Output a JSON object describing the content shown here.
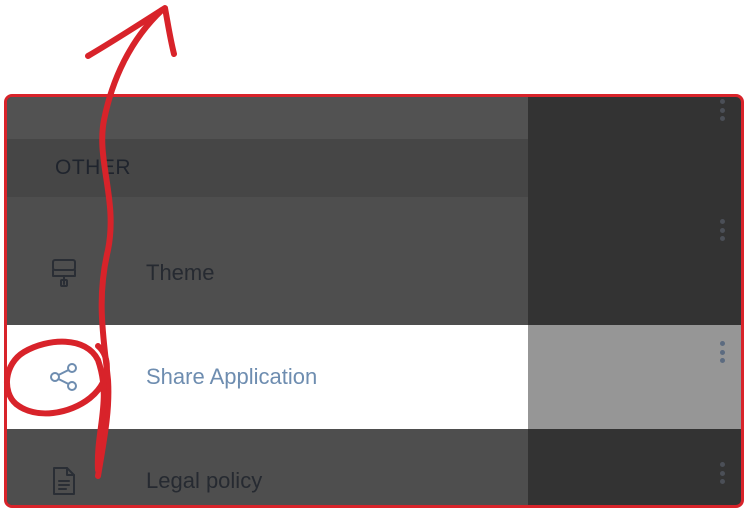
{
  "drawer": {
    "section_header": "OTHER",
    "items": [
      {
        "label": "Theme",
        "icon": "paint-roller-icon"
      },
      {
        "label": "Share Application",
        "icon": "share-icon",
        "active": true
      },
      {
        "label": "Legal policy",
        "icon": "document-icon"
      }
    ]
  },
  "colors": {
    "active_label": "#6e8db0",
    "annotation": "#d8232a",
    "overlay_dark": "#333333"
  }
}
